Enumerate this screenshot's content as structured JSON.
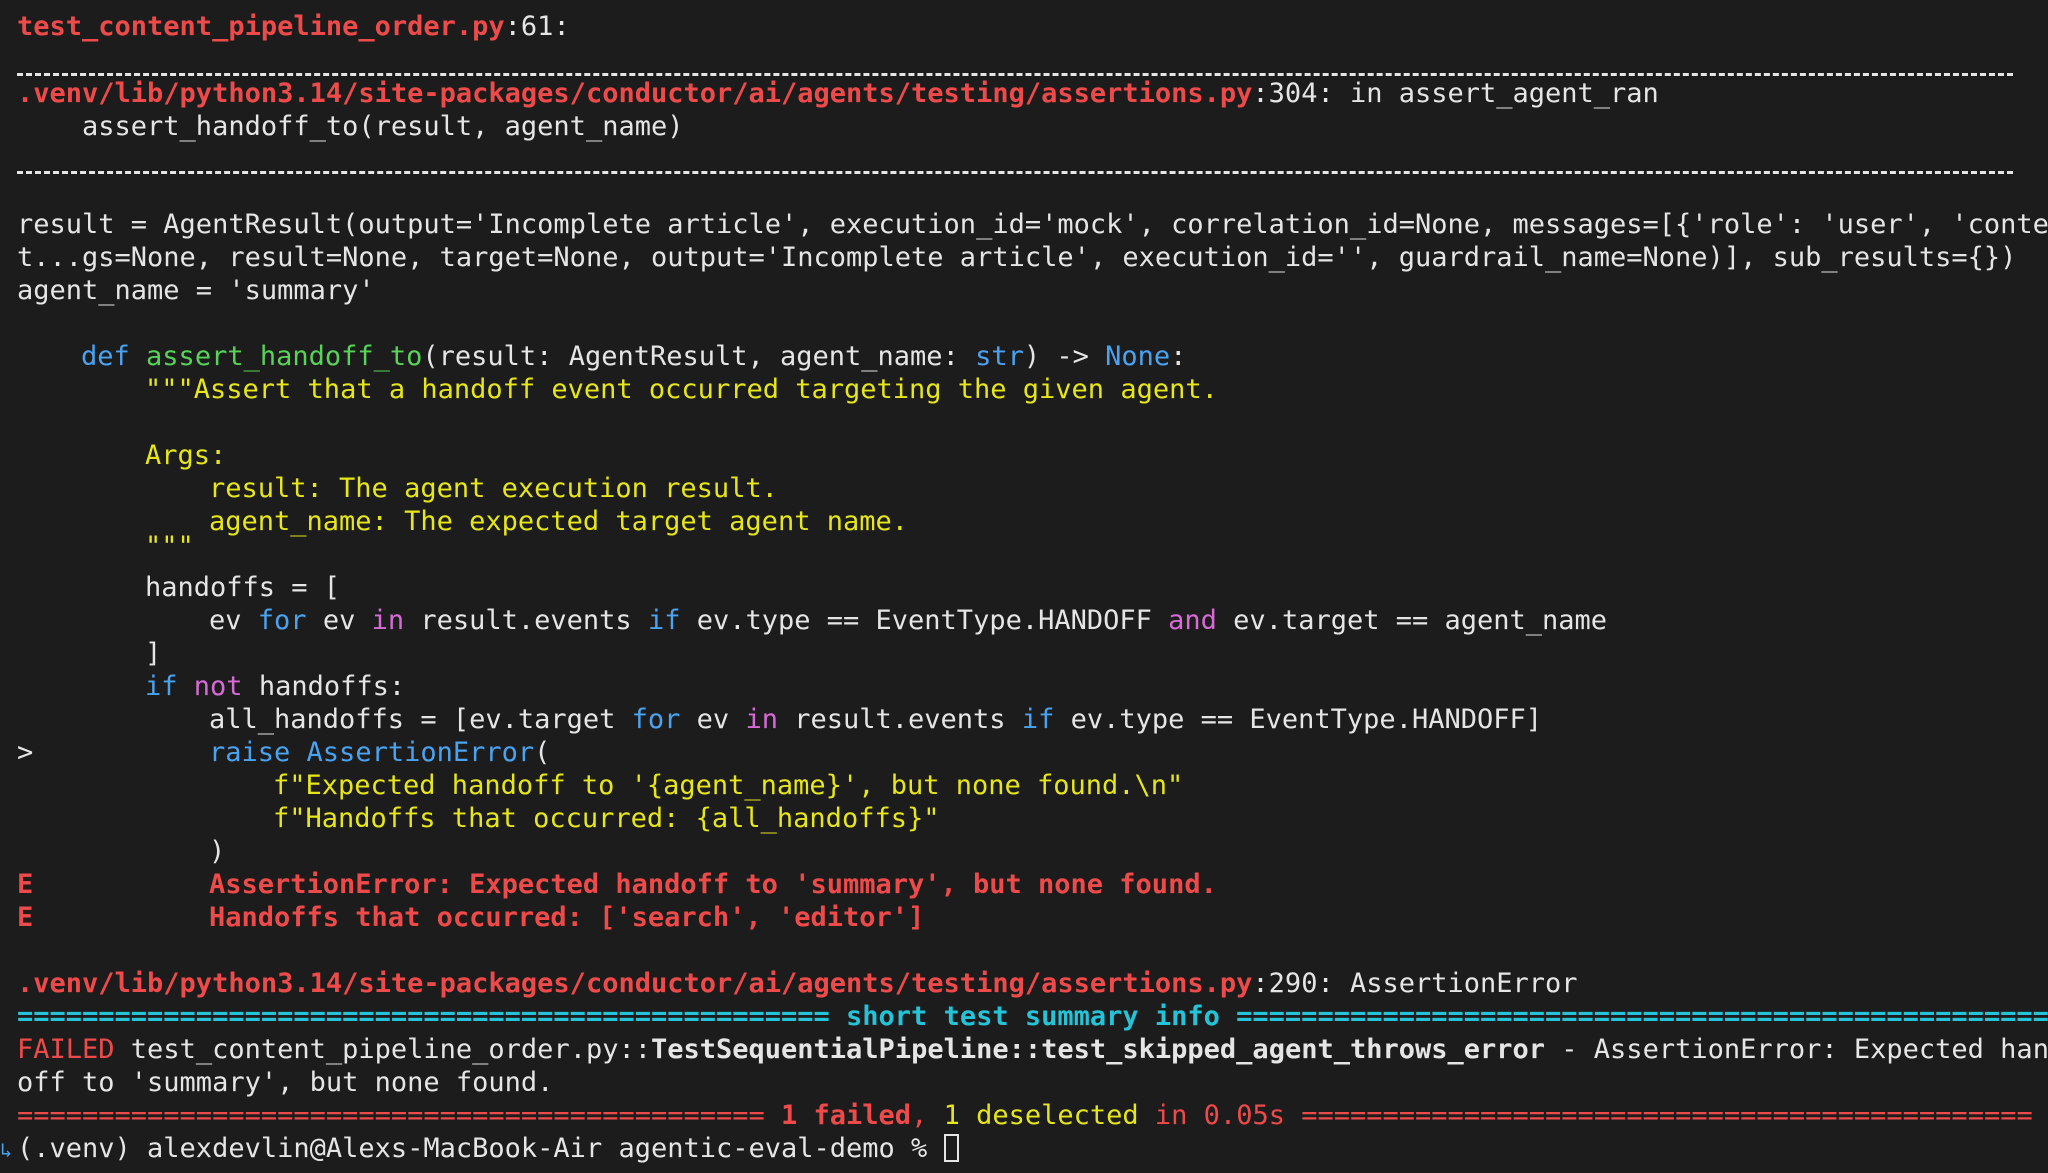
{
  "header": {
    "test_file": "test_content_pipeline_order.py",
    "test_line": ":61:"
  },
  "frame1": {
    "path": ".venv/lib/python3.14/site-packages/conductor/ai/agents/testing/assertions.py",
    "location": ":304: in assert_agent_ran",
    "call": "    assert_handoff_to(result, agent_name)"
  },
  "locals": {
    "line1": "result = AgentResult(output='Incomplete article', execution_id='mock', correlation_id=None, messages=[{'role': 'user', 'conten",
    "line2": "t...gs=None, result=None, target=None, output='Incomplete article', execution_id='', guardrail_name=None)], sub_results={})",
    "line3": "agent_name = 'summary'"
  },
  "code": {
    "def_kw": "def",
    "func_name": "assert_handoff_to",
    "sig_mid": "(result: AgentResult, agent_name: ",
    "str_kw": "str",
    "arrow": ") -> ",
    "none_kw": "None",
    "colon": ":",
    "doc1": "\"\"\"Assert that a handoff event occurred targeting the given agent.",
    "doc_args": "Args:",
    "doc_result": "result: The agent execution result.",
    "doc_agent": "agent_name: The expected target agent name.",
    "doc_end": "\"\"\"",
    "handoffs_open": "handoffs = [",
    "comp_ev": "ev ",
    "comp_for": "for",
    "comp_ev2": " ev ",
    "comp_in": "in",
    "comp_events": " result.events ",
    "comp_if": "if",
    "comp_cond": " ev.type == EventType.HANDOFF ",
    "comp_and": "and",
    "comp_cond2": " ev.target == agent_name",
    "bracket_close": "]",
    "if_kw": "if",
    "not_kw": "not",
    "if_rest": " handoffs:",
    "all_a": "all_handoffs = [ev.target ",
    "all_for": "for",
    "all_ev": " ev ",
    "all_in": "in",
    "all_events": " result.events ",
    "all_if": "if",
    "all_rest": " ev.type == EventType.HANDOFF]",
    "marker": ">",
    "raise_kw": "raise",
    "assert_err": "AssertionError",
    "raise_paren": "(",
    "fstr1": "f\"Expected handoff to '{agent_name}', but none found.\\n\"",
    "fstr2": "f\"Handoffs that occurred: {all_handoffs}\"",
    "paren_close": ")"
  },
  "errors": {
    "e_marker": "E",
    "e1": "AssertionError: Expected handoff to 'summary', but none found.",
    "e2": "Handoffs that occurred: ['search', 'editor']"
  },
  "frame2": {
    "path": ".venv/lib/python3.14/site-packages/conductor/ai/agents/testing/assertions.py",
    "location": ":290: AssertionError"
  },
  "summary": {
    "eq_left": "================================================== ",
    "title": "short test summary info",
    "eq_right": " ===================================================",
    "failed_label": "FAILED",
    "failed_file": " test_content_pipeline_order.py::",
    "failed_class": "TestSequentialPipeline::test_skipped_agent_throws_error",
    "failed_msg1": " - AssertionError: Expected hand",
    "failed_msg2": "off to 'summary', but none found."
  },
  "result_line": {
    "eq_left": "============================================== ",
    "failed_count": "1 failed",
    "comma": ", ",
    "deselected": "1 deselected",
    "time": " in 0.05s ",
    "eq_right": "============================================="
  },
  "prompt": {
    "text": "(.venv) alexdevlin@Alexs-MacBook-Air agentic-eval-demo % "
  },
  "colors": {
    "background": "#1c1c1c",
    "text": "#e5e5e5",
    "red": "#ef4a4a",
    "blue": "#4aa3f0",
    "purple": "#d86ad8",
    "green": "#57d357",
    "yellow": "#e6e619",
    "cyan": "#24c3d8"
  }
}
